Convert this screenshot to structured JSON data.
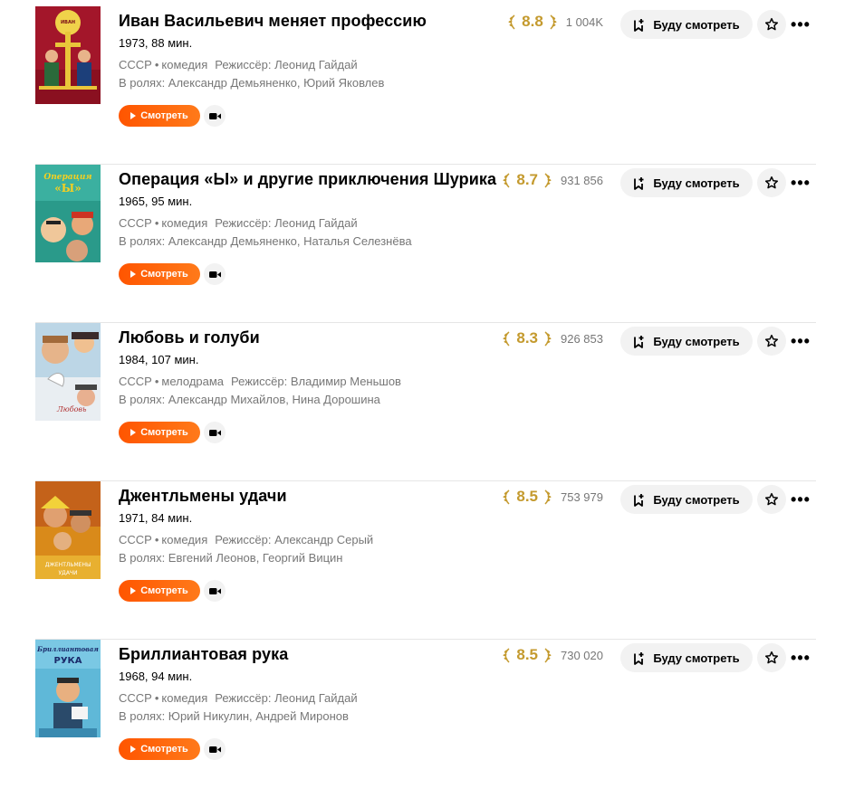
{
  "movies": [
    {
      "title": "Иван Васильевич меняет профессию",
      "year_length": "1973, 88 мин.",
      "country": "СССР",
      "genre": "комедия",
      "director": "Режиссёр: Леонид Гайдай",
      "cast": "В ролях: Александр Демьяненко, Юрий Яковлев",
      "rating": "8.8",
      "votes": "1 004K",
      "watch_label": "Смотреть",
      "future_label": "Буду смотреть",
      "poster_text": "Иван Васильевич меняет профессию"
    },
    {
      "title": "Операция «Ы» и другие приключения Шурика",
      "year_length": "1965, 95 мин.",
      "country": "СССР",
      "genre": "комедия",
      "director": "Режиссёр: Леонид Гайдай",
      "cast": "В ролях: Александр Демьяненко, Наталья Селезнёва",
      "rating": "8.7",
      "votes": "931 856",
      "watch_label": "Смотреть",
      "future_label": "Буду смотреть",
      "poster_text": "Операция Ы"
    },
    {
      "title": "Любовь и голуби",
      "year_length": "1984, 107 мин.",
      "country": "СССР",
      "genre": "мелодрама",
      "director": "Режиссёр: Владимир Меньшов",
      "cast": "В ролях: Александр Михайлов, Нина Дорошина",
      "rating": "8.3",
      "votes": "926 853",
      "watch_label": "Смотреть",
      "future_label": "Буду смотреть",
      "poster_text": "Любовь и голуби"
    },
    {
      "title": "Джентльмены удачи",
      "year_length": "1971, 84 мин.",
      "country": "СССР",
      "genre": "комедия",
      "director": "Режиссёр: Александр Серый",
      "cast": "В ролях: Евгений Леонов, Георгий Вицин",
      "rating": "8.5",
      "votes": "753 979",
      "watch_label": "Смотреть",
      "future_label": "Буду смотреть",
      "poster_text": "Джентльмены удачи"
    },
    {
      "title": "Бриллиантовая рука",
      "year_length": "1968, 94 мин.",
      "country": "СССР",
      "genre": "комедия",
      "director": "Режиссёр: Леонид Гайдай",
      "cast": "В ролях: Юрий Никулин, Андрей Миронов",
      "rating": "8.5",
      "votes": "730 020",
      "watch_label": "Смотреть",
      "future_label": "Буду смотреть",
      "poster_text": "Бриллиантовая рука"
    }
  ],
  "colors": {
    "rating_gold": "#c49a2e",
    "watch_orange": "#ff5500",
    "button_grey": "#f2f2f2",
    "meta_grey": "#777777"
  },
  "icons": {
    "watch": "play-icon",
    "trailer": "camera-icon",
    "future": "bookmark-plus-icon",
    "favorite": "star-icon",
    "more": "ellipsis-icon",
    "rating": "laurel-icon"
  }
}
